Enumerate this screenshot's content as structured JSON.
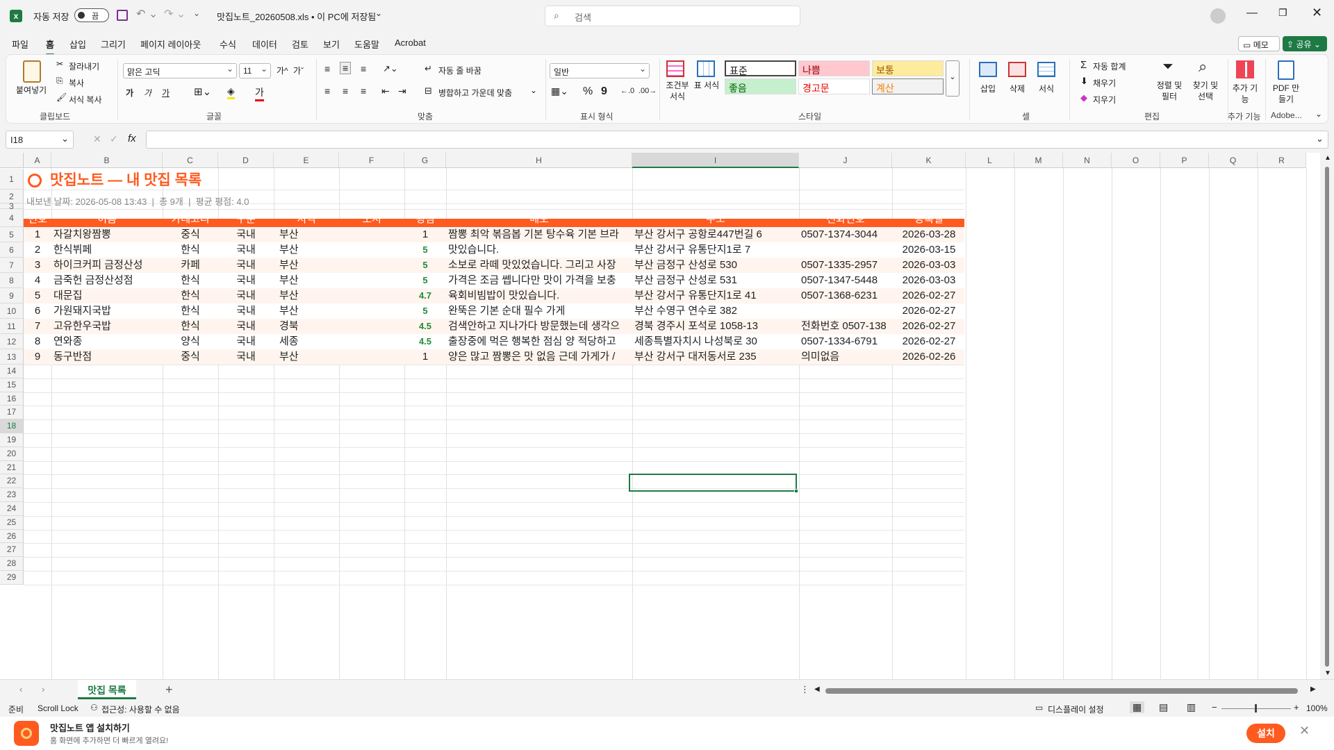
{
  "titlebar": {
    "autosave_label": "자동 저장",
    "toggle_state": "끔",
    "doc_title": "맛집노트_20260508.xls • 이 PC에 저장됨",
    "search_placeholder": "검색"
  },
  "menu": [
    "파일",
    "홈",
    "삽입",
    "그리기",
    "페이지 레이아웃",
    "수식",
    "데이터",
    "검토",
    "보기",
    "도움말",
    "Acrobat"
  ],
  "menu_right": {
    "memo": "메모",
    "share": "공유"
  },
  "ribbon": {
    "clipboard": {
      "paste": "붙여넣기",
      "cut": "잘라내기",
      "copy": "복사",
      "format_painter": "서식 복사",
      "group": "클립보드"
    },
    "font": {
      "name": "맑은 고딕",
      "size": "11",
      "group": "글꼴",
      "bold": "가",
      "italic": "가",
      "underline": "가"
    },
    "align": {
      "wrap": "자동 줄 바꿈",
      "merge": "병합하고 가운데 맞춤",
      "group": "맞춤"
    },
    "number": {
      "format": "일반",
      "percent": "%",
      "comma": "9",
      "group": "표시 형식"
    },
    "styles": {
      "cond": "조건부 서식",
      "table": "표 서식",
      "normal": "표준",
      "bad": "나쁨",
      "neutral": "보통",
      "good": "좋음",
      "warning": "경고문",
      "calc": "계산",
      "group": "스타일"
    },
    "cells": {
      "insert": "삽입",
      "delete": "삭제",
      "format": "서식",
      "group": "셀"
    },
    "editing": {
      "autosum": "자동 합계",
      "fill": "채우기",
      "clear": "지우기",
      "sort": "정렬 및 필터",
      "find": "찾기 및 선택",
      "group": "편집"
    },
    "addins": {
      "label": "추가 기능",
      "group": "추가 기능"
    },
    "adobe": {
      "label": "PDF 만들기",
      "group": "Adobe..."
    }
  },
  "namebox": "I18",
  "columns": [
    "A",
    "B",
    "C",
    "D",
    "E",
    "F",
    "G",
    "H",
    "I",
    "J",
    "K",
    "L",
    "M",
    "N",
    "O",
    "P",
    "Q",
    "R"
  ],
  "rows": [
    "1",
    "2",
    "3",
    "4",
    "5",
    "6",
    "7",
    "8",
    "9",
    "10",
    "11",
    "12",
    "13",
    "14",
    "15",
    "16",
    "17",
    "18",
    "19",
    "20",
    "21",
    "22",
    "23",
    "24",
    "25",
    "26",
    "27",
    "28",
    "29"
  ],
  "sheet": {
    "title": "맛집노트 — 내 맛집 목록",
    "subtitle": "내보낸 날짜: 2026-05-08 13:43  |  총 9개  |  평균 평점: 4.0",
    "headers": [
      "번호",
      "이름",
      "카테고리",
      "구분",
      "지역",
      "도시",
      "평점",
      "메모",
      "주소",
      "전화번호",
      "등록일"
    ],
    "records": [
      [
        "1",
        "자갈치왕짬뽕",
        "중식",
        "국내",
        "부산",
        "",
        "1",
        "짬뽕 최악 볶음봅 기본 탕수육 기본 브라",
        "부산 강서구 공항로447번길 6",
        "0507-1374-3044",
        "2026-03-28"
      ],
      [
        "2",
        "한식뷔페",
        "한식",
        "국내",
        "부산",
        "",
        "5",
        "맛있습니다.",
        "부산 강서구 유통단지1로 7",
        "",
        "2026-03-15"
      ],
      [
        "3",
        "하이크커피 금정산성",
        "카페",
        "국내",
        "부산",
        "",
        "5",
        "소보로 라떼 맛있었습니다. 그리고 사장",
        "부산 금정구 산성로 530",
        "0507-1335-2957",
        "2026-03-03"
      ],
      [
        "4",
        "금죽헌 금정산성점",
        "한식",
        "국내",
        "부산",
        "",
        "5",
        "가격은 조금 쎕니다만 맛이 가격을 보충",
        "부산 금정구 산성로 531",
        "0507-1347-5448",
        "2026-03-03"
      ],
      [
        "5",
        "대문집",
        "한식",
        "국내",
        "부산",
        "",
        "4.7",
        "육회비빔밥이 맛있습니다.",
        "부산 강서구 유통단지1로 41",
        "0507-1368-6231",
        "2026-02-27"
      ],
      [
        "6",
        "가원돼지국밥",
        "한식",
        "국내",
        "부산",
        "",
        "5",
        "완뚝은 기본 순대 필수 가게",
        "부산 수영구 연수로 382",
        "",
        "2026-02-27"
      ],
      [
        "7",
        "고유한우국밥",
        "한식",
        "국내",
        "경북",
        "",
        "4.5",
        "검색안하고 지나가다 방문했는데 생각으",
        "경북 경주시 포석로 1058-13",
        "전화번호 0507-138",
        "2026-02-27"
      ],
      [
        "8",
        "연와종",
        "양식",
        "국내",
        "세종",
        "",
        "4.5",
        "출장중에 먹은 행복한 점심 양 적당하고",
        "세종특별자치시 나성북로 30",
        "0507-1334-6791",
        "2026-02-27"
      ],
      [
        "9",
        "동구반점",
        "중식",
        "국내",
        "부산",
        "",
        "1",
        "양은 많고 짬뽕은 맛 없음 근데 가게가 /",
        "부산 강서구 대저동서로 235",
        "의미없음",
        "2026-02-26"
      ]
    ]
  },
  "sheet_tab": "맛집 목록",
  "status": {
    "ready": "준비",
    "scroll": "Scroll Lock",
    "access": "접근성: 사용할 수 없음",
    "display": "디스플레이 설정",
    "zoom": "100%"
  },
  "banner": {
    "title": "맛집노트 앱 설치하기",
    "subtitle": "홈 화면에 추가하면 더 빠르게 열려요!",
    "install": "설치"
  },
  "colors": {
    "accent": "#ff5a1f",
    "excel_green": "#1e7a45",
    "stripe": "#fff5ee"
  }
}
